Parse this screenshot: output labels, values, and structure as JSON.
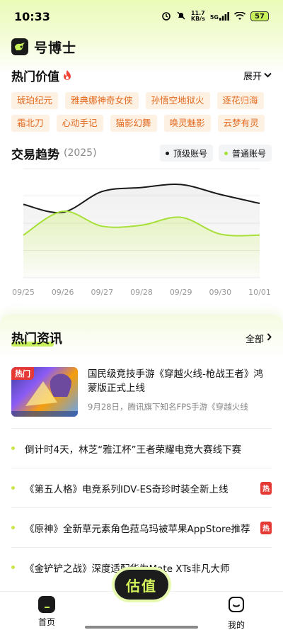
{
  "status_bar": {
    "time": "10:33",
    "net_speed": "11.7",
    "net_unit": "KB/s",
    "signal": "5G",
    "battery": "57"
  },
  "app": {
    "title": "号博士"
  },
  "hot_value": {
    "title": "热门价值",
    "expand_label": "展开",
    "tags": [
      "琥珀纪元",
      "雅典娜神奇女侠",
      "孙悟空地狱火",
      "逐花归海",
      "霜北刀",
      "心动手记",
      "猫影幻舞",
      "唤灵魅影",
      "云梦有灵"
    ]
  },
  "trend": {
    "title": "交易趋势",
    "year": "(2025)",
    "legend": [
      {
        "label": "顶级账号",
        "color": "#1a1a1a"
      },
      {
        "label": "普通账号",
        "color": "#a8e03a"
      }
    ]
  },
  "chart_data": {
    "type": "line",
    "x": [
      "09/25",
      "09/26",
      "09/27",
      "09/28",
      "09/29",
      "09/30",
      "10/01"
    ],
    "series": [
      {
        "name": "顶级账号",
        "values": [
          74,
          66,
          87,
          91,
          94,
          84,
          75
        ]
      },
      {
        "name": "普通账号",
        "values": [
          43,
          67,
          52,
          53,
          61,
          44,
          43
        ]
      }
    ],
    "ylim": [
      0,
      110
    ],
    "grid": true
  },
  "news": {
    "title": "热门资讯",
    "all_label": "全部",
    "featured": {
      "badge": "热门",
      "title": "国民级竞技手游《穿越火线-枪战王者》鸿蒙版正式上线",
      "subtitle": "9月28日，腾讯旗下知名FPS手游《穿越火线"
    },
    "items": [
      {
        "text": "倒计时4天，林芝“雅江杯”王者荣耀电竞大赛线下赛",
        "hot": ""
      },
      {
        "text": "《第五人格》电竞系列IDV-ES奇珍时装全新上线",
        "hot": "热"
      },
      {
        "text": "《原神》全新草元素角色菈乌玛被苹果AppStore推荐",
        "hot": "热"
      },
      {
        "text": "《金铲铲之战》深度适配华为Mate XTs非凡大师",
        "hot": ""
      }
    ]
  },
  "bottom_nav": {
    "home": "首页",
    "estimate": "估值",
    "mine": "我的"
  }
}
